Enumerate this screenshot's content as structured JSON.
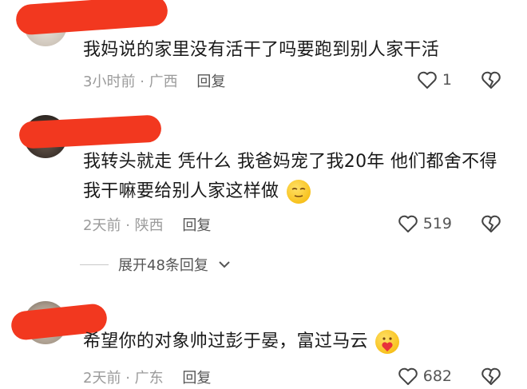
{
  "comments": [
    {
      "text": "我妈说的家里没有活干了吗要跑到别人家干活",
      "time": "3小时前",
      "location": "广西",
      "reply_label": "回复",
      "likes": "1"
    },
    {
      "text": "我转头就走 凭什么 我爸妈宠了我20年 他们都舍不得 我干嘛要给别人家这样做",
      "time": "2天前",
      "location": "陕西",
      "reply_label": "回复",
      "likes": "519",
      "expand_label": "展开48条回复"
    },
    {
      "text": "希望你的对象帅过彭于晏，富过马云",
      "time": "2天前",
      "location": "广东",
      "reply_label": "回复",
      "likes": "682"
    }
  ],
  "icons": {
    "like": "heart-outline-icon",
    "dislike": "broken-heart-icon",
    "expand": "chevron-down-icon"
  },
  "colors": {
    "redaction": "#f2381f",
    "text": "#1a1a1a",
    "meta": "#9b9b9b"
  }
}
